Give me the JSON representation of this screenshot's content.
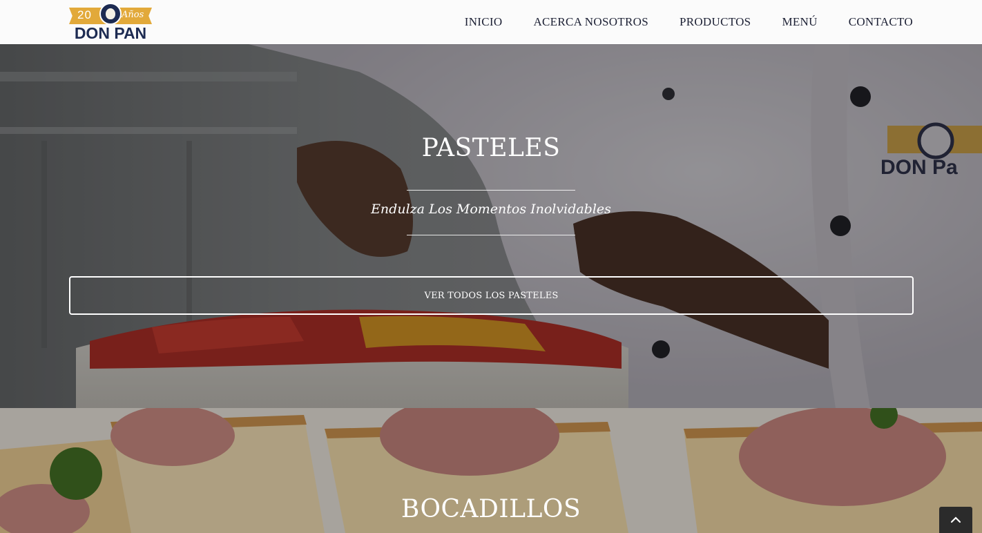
{
  "header": {
    "logo": {
      "years": "20",
      "anos": "Años",
      "brand": "DON PAN"
    },
    "nav": [
      "INICIO",
      "ACERCA NOSOTROS",
      "PRODUCTOS",
      "MENÚ",
      "CONTACTO"
    ]
  },
  "hero_pasteles": {
    "title": "PASTELES",
    "tagline": "Endulza Los Momentos Inolvidables",
    "cta": "VER TODOS LOS PASTELES"
  },
  "hero_bocadillos": {
    "title": "BOCADILLOS"
  },
  "icons": {
    "scroll_top": "chevron-up-icon"
  },
  "colors": {
    "brand_navy": "#1d2b52",
    "brand_gold": "#e2a93a",
    "header_bg": "#fbfbfb"
  }
}
